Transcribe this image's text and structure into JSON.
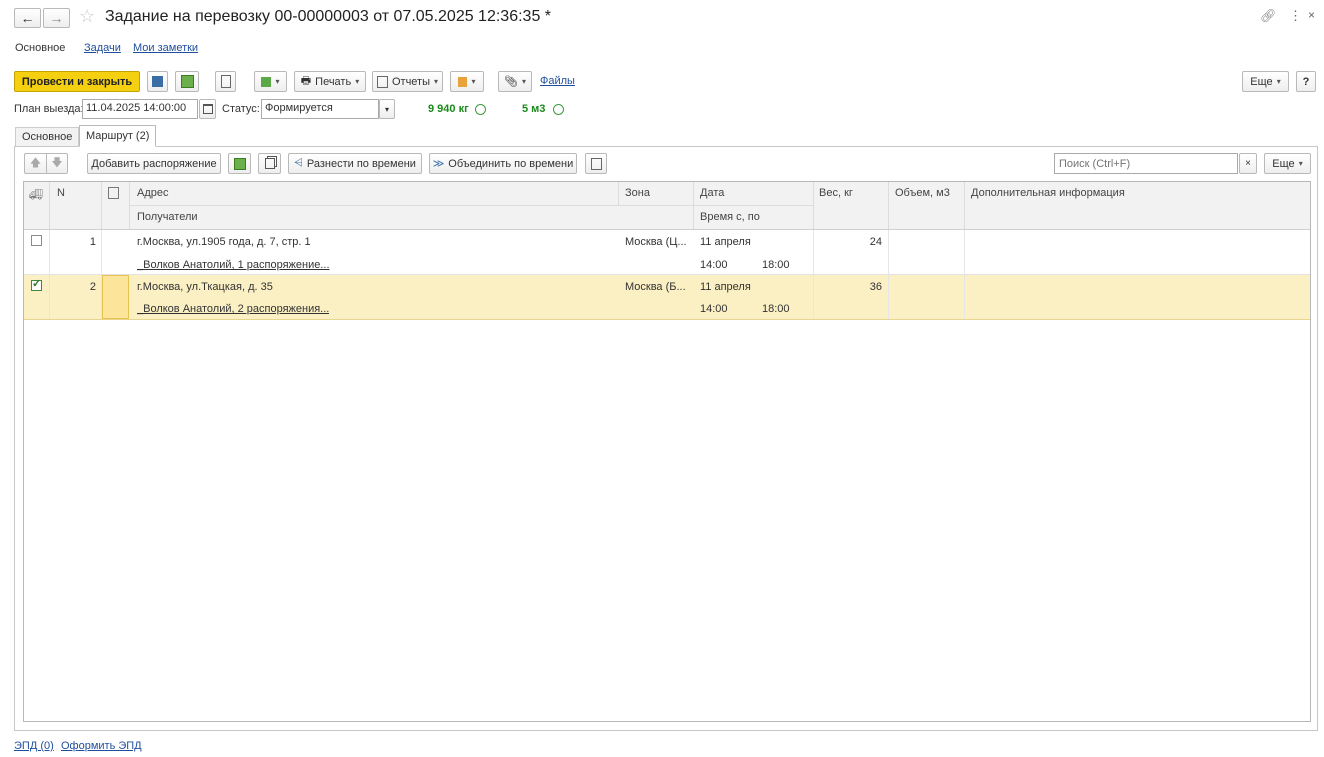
{
  "window": {
    "title": "Задание на перевозку 00-00000003 от 07.05.2025 12:36:35 *"
  },
  "nav_tabs": [
    "Основное",
    "Задачи",
    "Мои заметки"
  ],
  "toolbar": {
    "post_close": "Провести и закрыть",
    "print": "Печать",
    "reports": "Отчеты",
    "files": "Файлы",
    "more": "Еще",
    "help": "?"
  },
  "header": {
    "plan_label": "План выезда:",
    "plan_value": "11.04.2025 14:00:00",
    "status_label": "Статус:",
    "status_value": "Формируется",
    "weight": "9 940 кг",
    "volume": "5 м3"
  },
  "tabs": [
    "Основное",
    "Маршрут (2)"
  ],
  "route_toolbar": {
    "add_order": "Добавить распоряжение",
    "distribute_time": "Разнести по времени",
    "combine_time": "Объединить по времени",
    "search_placeholder": "Поиск (Ctrl+F)",
    "more": "Еще"
  },
  "table": {
    "headers": {
      "n": "N",
      "address": "Адрес",
      "recipients": "Получатели",
      "zone": "Зона",
      "date": "Дата",
      "time": "Время с, по",
      "weight": "Вес, кг",
      "volume": "Объем, м3",
      "info": "Дополнительная информация"
    },
    "rows": [
      {
        "checked": false,
        "n": "1",
        "address": "г.Москва, ул.1905 года, д. 7, стр. 1",
        "recipients": "_Волков Анатолий, 1 распоряжение...",
        "zone": "Москва (Ц...",
        "date": "11 апреля",
        "time_from": "14:00",
        "time_to": "18:00",
        "weight": "24",
        "volume": "",
        "info": ""
      },
      {
        "checked": true,
        "n": "2",
        "address": "г.Москва, ул.Ткацкая, д. 35",
        "recipients": "_Волков Анатолий, 2 распоряжения...",
        "zone": "Москва (Б...",
        "date": "11 апреля",
        "time_from": "14:00",
        "time_to": "18:00",
        "weight": "36",
        "volume": "",
        "info": ""
      }
    ]
  },
  "footer": {
    "epd": "ЭПД (0)",
    "make_epd": "Оформить ЭПД"
  },
  "colors": {
    "primary_button": "#f5d010",
    "selected_row": "#fbf0c4",
    "link": "#1f4e9c",
    "green_text": "#1a8a1a"
  }
}
